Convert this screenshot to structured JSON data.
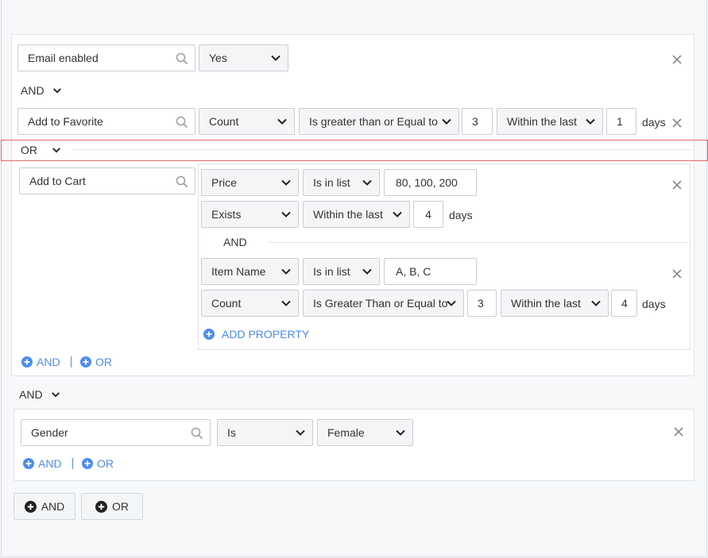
{
  "group1": {
    "row1": {
      "event": "Email enabled",
      "value": "Yes"
    },
    "connector": "AND",
    "row2": {
      "event": "Add to Favorite",
      "aggregate": "Count",
      "operator": "Is greater than or Equal to",
      "number": "3",
      "time_op": "Within the last",
      "time_value": "1",
      "unit": "days"
    },
    "or_connector": "OR",
    "row3": {
      "event": "Add to Cart",
      "prop1": {
        "name": "Price",
        "operator": "Is in list",
        "value": "80, 100, 200"
      },
      "prop2": {
        "name": "Exists",
        "time_op": "Within the last",
        "time_value": "4",
        "unit": "days"
      },
      "connector": "AND",
      "prop3": {
        "name": "Item Name",
        "operator": "Is in list",
        "value": "A, B, C"
      },
      "prop4": {
        "name": "Count",
        "operator": "Is Greater Than or Equal to",
        "number": "3",
        "time_op": "Within the last",
        "time_value": "4",
        "unit": "days"
      },
      "add_property": "ADD PROPERTY"
    },
    "and_link": "AND",
    "or_link": "OR"
  },
  "between_groups": "AND",
  "group2": {
    "event": "Gender",
    "operator": "Is",
    "value": "Female",
    "and_link": "AND",
    "or_link": "OR"
  },
  "footer": {
    "and_button": "AND",
    "or_button": "OR"
  },
  "colors": {
    "accent": "#4d8bf0",
    "highlight": "#e06a6a"
  }
}
